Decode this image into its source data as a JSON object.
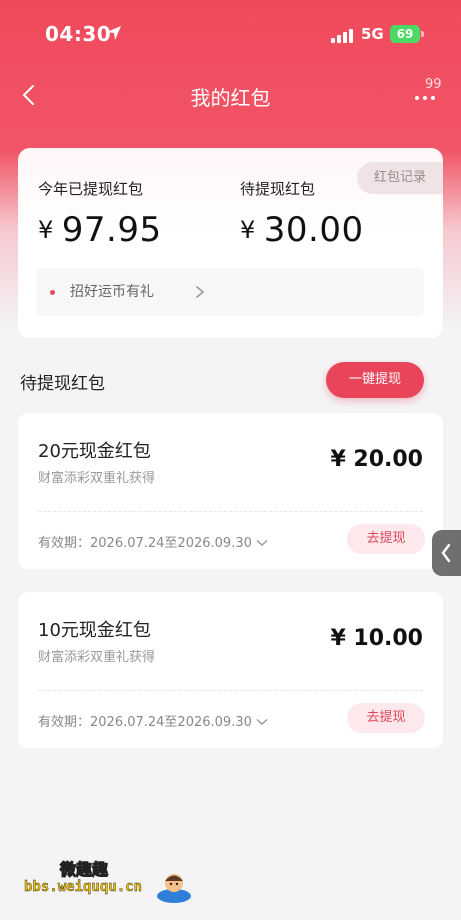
{
  "status_bar": {
    "time": "04:30",
    "network": "5G",
    "battery": "69"
  },
  "nav": {
    "title": "我的红包",
    "message_count": "99"
  },
  "summary": {
    "record_button": "红包记录",
    "withdrawn_label": "今年已提现红包",
    "withdrawn_currency": "¥",
    "withdrawn_amount": "97.95",
    "pending_label": "待提现红包",
    "pending_currency": "¥",
    "pending_amount": "30.00",
    "promo_text": "招好运币有礼"
  },
  "section": {
    "title": "待提现红包",
    "withdraw_all_button": "一键提现"
  },
  "packets": [
    {
      "name": "20元现金红包",
      "source": "财富添彩双重礼获得",
      "amount": "¥ 20.00",
      "validity": "有效期：2026.07.24至2026.09.30",
      "button": "去提现"
    },
    {
      "name": "10元现金红包",
      "source": "财富添彩双重礼获得",
      "amount": "¥ 10.00",
      "validity": "有效期：2026.07.24至2026.09.30",
      "button": "去提现"
    }
  ],
  "watermark": {
    "title": "微趣趣",
    "url": "bbs.weiququ.cn"
  },
  "colors": {
    "brand_red": "#e8455a",
    "header_red": "#ef4a5c",
    "battery_green": "#4cd964"
  }
}
